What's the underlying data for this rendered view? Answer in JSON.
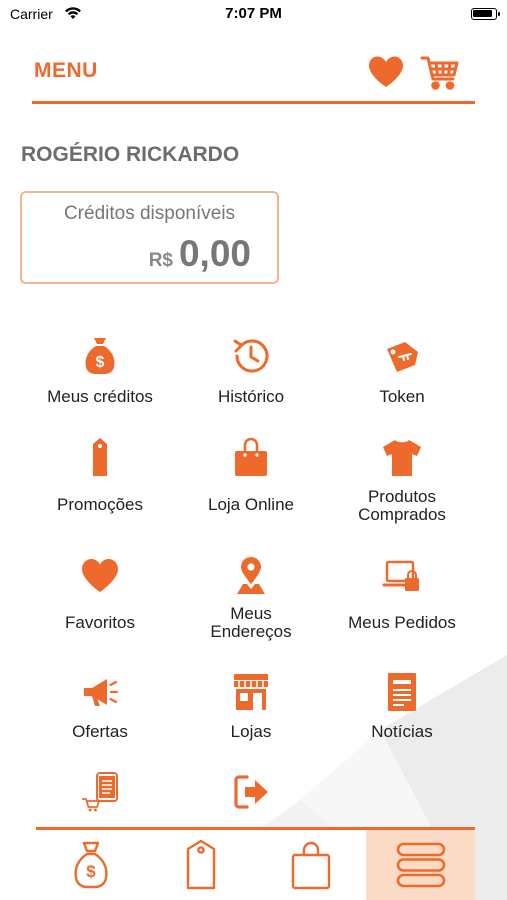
{
  "status_bar": {
    "carrier": "Carrier",
    "time": "7:07 PM"
  },
  "header": {
    "title": "MENU",
    "favorites_icon": "heart-icon",
    "cart_icon": "cart-icon"
  },
  "user": {
    "name": "ROGÉRIO RICKARDO"
  },
  "credits": {
    "label": "Créditos disponíveis",
    "currency": "R$",
    "amount": "0,00"
  },
  "menu_items": [
    {
      "label": "Meus créditos",
      "icon": "money-bag-icon"
    },
    {
      "label": "Histórico",
      "icon": "history-icon"
    },
    {
      "label": "Token",
      "icon": "key-tag-icon"
    },
    {
      "label": "Promoções",
      "icon": "tag-icon"
    },
    {
      "label": "Loja Online",
      "icon": "shopping-bag-icon"
    },
    {
      "label": "Produtos Comprados",
      "icon": "tshirt-icon"
    },
    {
      "label": "Favoritos",
      "icon": "heart-icon"
    },
    {
      "label": "Meus Endereços",
      "icon": "location-pin-icon"
    },
    {
      "label": "Meus Pedidos",
      "icon": "laptop-bag-icon"
    },
    {
      "label": "Ofertas",
      "icon": "megaphone-icon"
    },
    {
      "label": "Lojas",
      "icon": "storefront-icon"
    },
    {
      "label": "Notícias",
      "icon": "newspaper-icon"
    },
    {
      "label": "",
      "icon": "receipt-cart-icon"
    },
    {
      "label": "",
      "icon": "logout-icon"
    }
  ],
  "tab_bar": {
    "tabs": [
      {
        "icon": "money-bag-icon",
        "active": false
      },
      {
        "icon": "tag-icon",
        "active": false
      },
      {
        "icon": "shopping-bag-icon",
        "active": false
      },
      {
        "icon": "menu-icon",
        "active": true
      }
    ]
  },
  "colors": {
    "accent": "#ee6a2c",
    "card_border": "#f4b48c",
    "active_tab_bg": "#fbdbc6",
    "muted_text": "#777777"
  }
}
